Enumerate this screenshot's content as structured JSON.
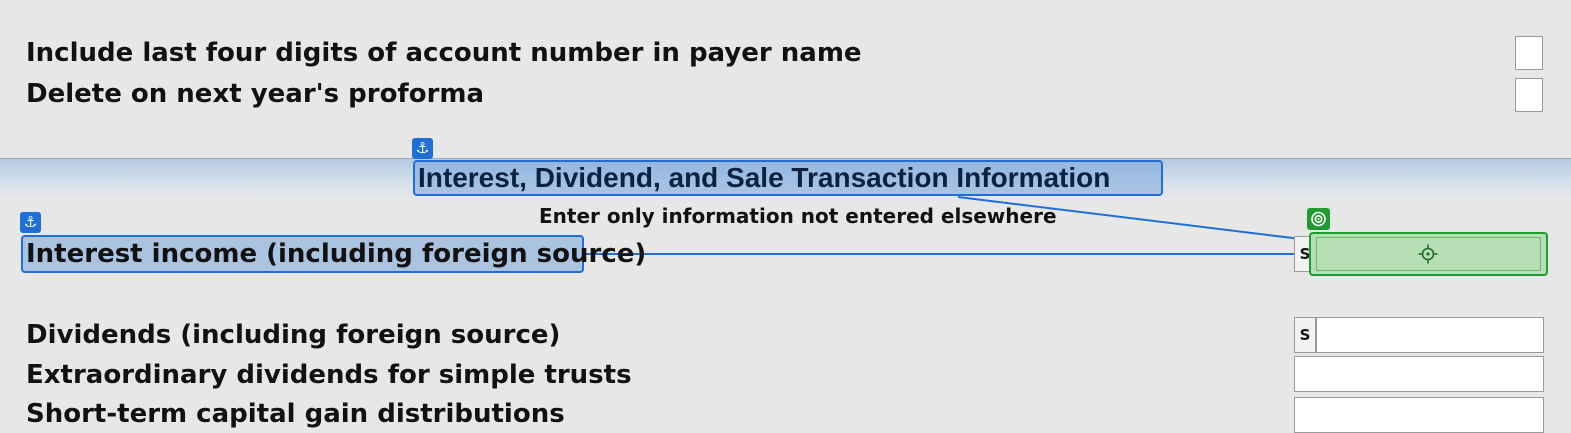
{
  "options": {
    "include_last_four_label": "Include last four digits of account number in payer name",
    "delete_next_year_label": "Delete on next year's proforma"
  },
  "section": {
    "title": "Interest, Dividend, and Sale Transaction Information",
    "subtitle": "Enter only information not entered elsewhere"
  },
  "fields": {
    "interest_label": "Interest income (including foreign source)",
    "dividends_label": "Dividends (including foreign source)",
    "extraordinary_label": "Extraordinary dividends for simple trusts",
    "short_term_label": "Short-term capital gain distributions",
    "s_button_label": "S"
  },
  "icons": {
    "anchor": "anchor-icon",
    "target": "target-icon",
    "crosshair": "crosshair-icon"
  },
  "colors": {
    "anchor_highlight": "#1f6fd6",
    "target_highlight": "#1f9b2f",
    "background": "#e7e7e7"
  }
}
